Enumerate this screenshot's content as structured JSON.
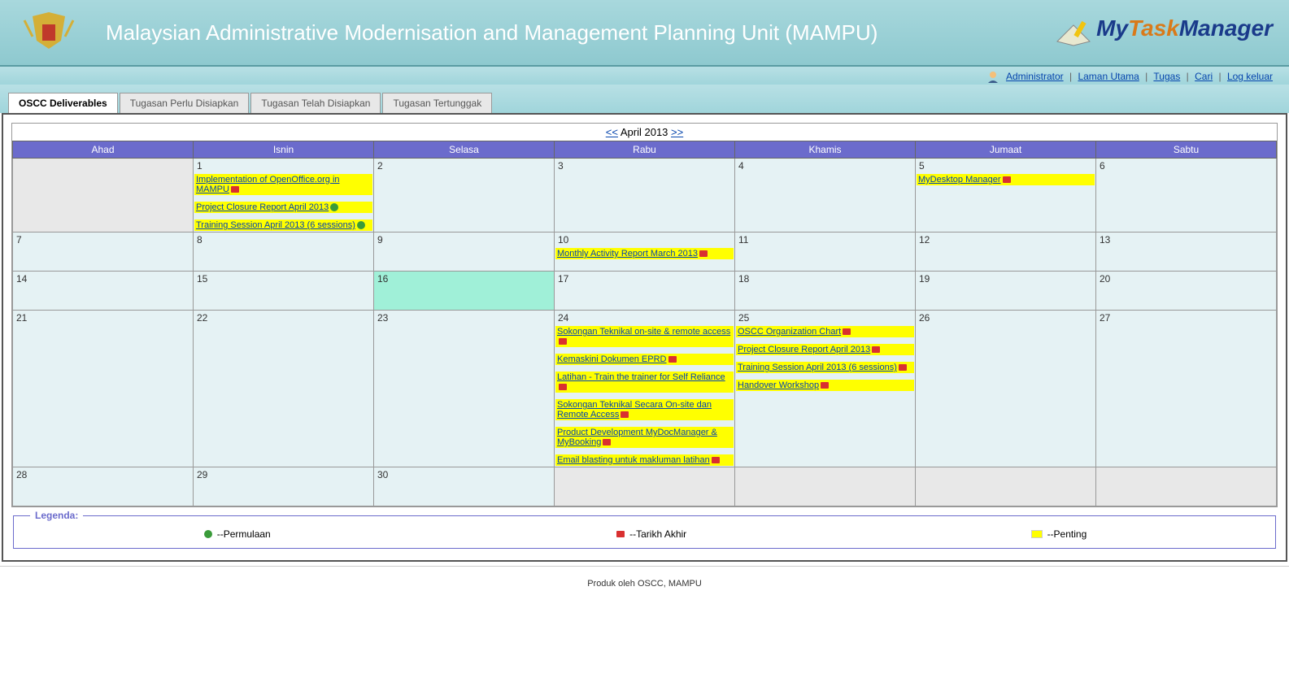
{
  "header": {
    "title": "Malaysian Administrative Modernisation and Management Planning Unit (MAMPU)",
    "brand_my": "My",
    "brand_task": "Task",
    "brand_mgr": "Manager"
  },
  "nav": {
    "admin": "Administrator",
    "home": "Laman Utama",
    "tasks": "Tugas",
    "search": "Cari",
    "logout": "Log keluar"
  },
  "tabs": [
    "OSCC Deliverables",
    "Tugasan Perlu Disiapkan",
    "Tugasan Telah Disiapkan",
    "Tugasan Tertunggak"
  ],
  "calendar": {
    "prev": "<<",
    "title": "April 2013",
    "next": ">>",
    "days": [
      "Ahad",
      "Isnin",
      "Selasa",
      "Rabu",
      "Khamis",
      "Jumaat",
      "Sabtu"
    ],
    "cells": {
      "d1": "1",
      "d2": "2",
      "d3": "3",
      "d4": "4",
      "d5": "5",
      "d6": "6",
      "d7": "7",
      "d8": "8",
      "d9": "9",
      "d10": "10",
      "d11": "11",
      "d12": "12",
      "d13": "13",
      "d14": "14",
      "d15": "15",
      "d16": "16",
      "d17": "17",
      "d18": "18",
      "d19": "19",
      "d20": "20",
      "d21": "21",
      "d22": "22",
      "d23": "23",
      "d24": "24",
      "d25": "25",
      "d26": "26",
      "d27": "27",
      "d28": "28",
      "d29": "29",
      "d30": "30"
    },
    "events": {
      "day1": [
        {
          "text": "Implementation of OpenOffice.org in MAMPU",
          "flag": "red"
        },
        {
          "text": "Project Closure Report April 2013",
          "flag": "green"
        },
        {
          "text": "Training Session April 2013 (6 sessions)",
          "flag": "green"
        }
      ],
      "day5": [
        {
          "text": "MyDesktop Manager",
          "flag": "red"
        }
      ],
      "day10": [
        {
          "text": "Monthly Activity Report March 2013",
          "flag": "red"
        }
      ],
      "day24": [
        {
          "text": "Sokongan Teknikal on-site & remote access",
          "flag": "red"
        },
        {
          "text": "Kemaskini Dokumen EPRD",
          "flag": "red"
        },
        {
          "text": "Latihan - Train the trainer for Self Reliance",
          "flag": "red"
        },
        {
          "text": "Sokongan Teknikal Secara On-site dan Remote Access",
          "flag": "red"
        },
        {
          "text": "Product Development MyDocManager & MyBooking",
          "flag": "red"
        },
        {
          "text": "Email blasting untuk makluman latihan",
          "flag": "red"
        }
      ],
      "day25": [
        {
          "text": "OSCC Organization Chart",
          "flag": "red"
        },
        {
          "text": "Project Closure Report April 2013",
          "flag": "red"
        },
        {
          "text": "Training Session April 2013 (6 sessions)",
          "flag": "red"
        },
        {
          "text": "Handover Workshop",
          "flag": "red"
        }
      ]
    }
  },
  "legend": {
    "title": "Legenda:",
    "start": "--Permulaan",
    "end": "--Tarikh Akhir",
    "important": "--Penting"
  },
  "footer": "Produk oleh OSCC, MAMPU"
}
